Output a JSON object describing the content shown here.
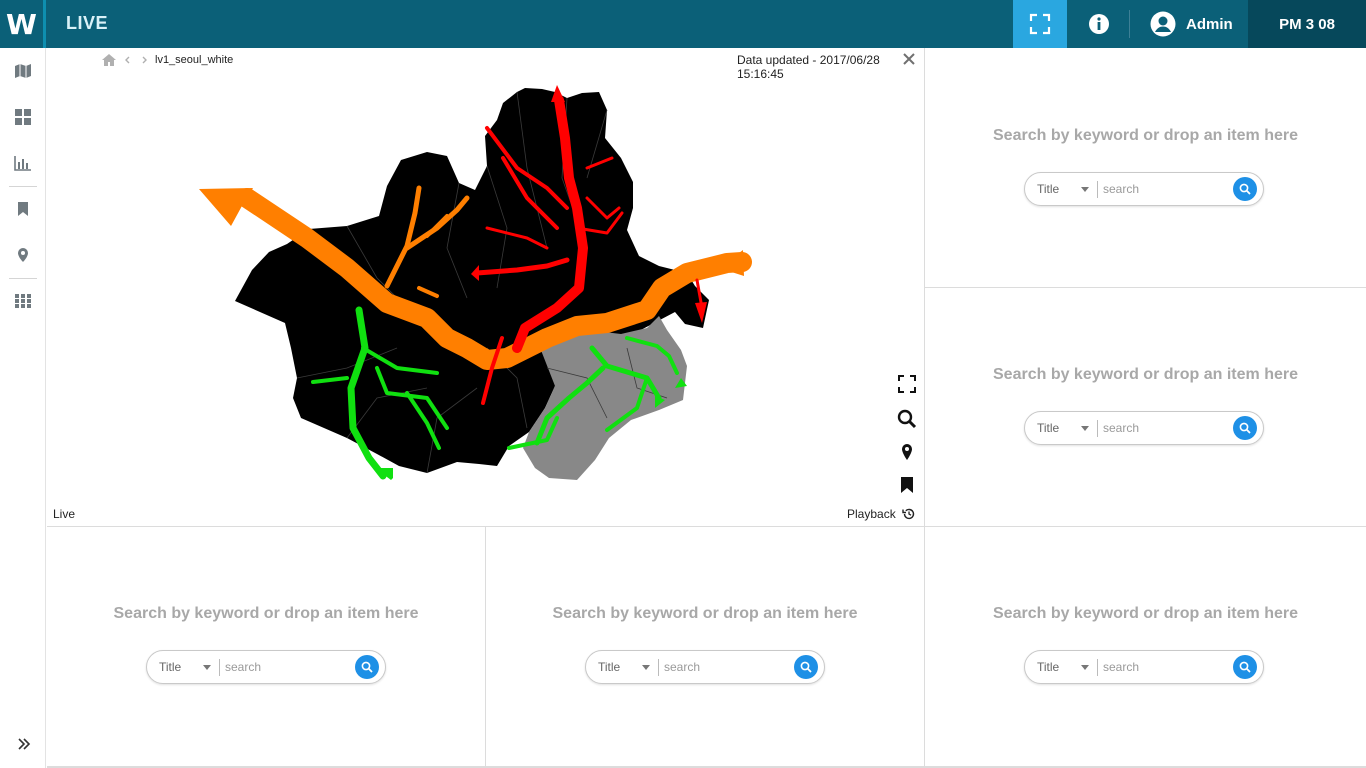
{
  "header": {
    "logo": "W",
    "title": "LIVE",
    "user_name": "Admin",
    "clock": "PM  3 08"
  },
  "sidebar": {
    "items": [
      {
        "icon": "map-icon"
      },
      {
        "icon": "dashboard-icon"
      },
      {
        "icon": "chart-icon"
      },
      {
        "icon": "bookmark-icon"
      },
      {
        "icon": "location-pin-icon"
      },
      {
        "icon": "apps-grid-icon"
      }
    ],
    "expand_icon": "double-chevron-right-icon"
  },
  "map_panel": {
    "breadcrumb": "lv1_seoul_white",
    "updated_text": "Data updated - 2017/06/28 15:16:45",
    "live_label": "Live",
    "playback_label": "Playback",
    "colors": {
      "flow_orange": "#ff7f00",
      "flow_red": "#ff0000",
      "flow_green": "#10e010",
      "district_black": "#000000",
      "district_gray": "#888888"
    }
  },
  "empty_panels": [
    {
      "drop_text": "Search by keyword or drop an item here",
      "select_value": "Title",
      "placeholder": "search"
    },
    {
      "drop_text": "Search by keyword or drop an item here",
      "select_value": "Title",
      "placeholder": "search"
    },
    {
      "drop_text": "Search by keyword or drop an item here",
      "select_value": "Title",
      "placeholder": "search"
    },
    {
      "drop_text": "Search by keyword or drop an item here",
      "select_value": "Title",
      "placeholder": "search"
    },
    {
      "drop_text": "Search by keyword or drop an item here",
      "select_value": "Title",
      "placeholder": "search"
    }
  ]
}
